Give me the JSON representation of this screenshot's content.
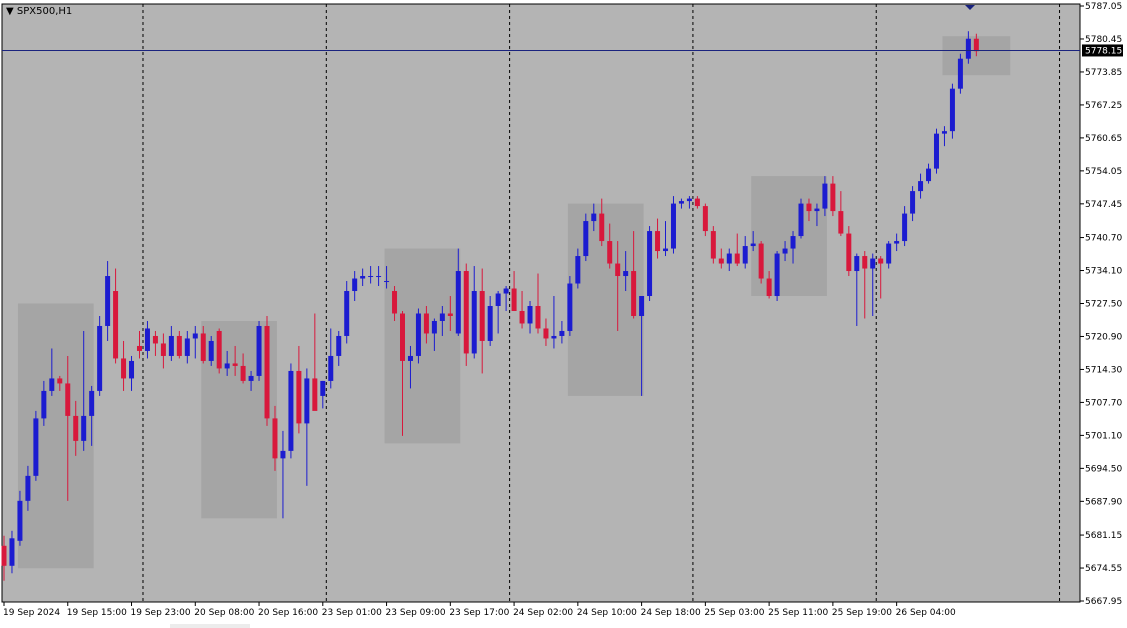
{
  "window": {
    "symbol_label": "SPX500,H1",
    "collapse_icon": "triangle-down-icon"
  },
  "colors": {
    "background": "#b4b4b4",
    "bull": "#1c1cd0",
    "bear": "#d8183c",
    "box": "#a5a5a5",
    "price_line": "#1a237e",
    "price_tag": "#000000"
  },
  "current_price": {
    "value": 5778.15,
    "label": "5778.15"
  },
  "chart_data": {
    "type": "candlestick",
    "title": "SPX500,H1",
    "ylim": [
      5667.95,
      5787.05
    ],
    "y_ticks": [
      "5787.05",
      "5780.45",
      "5773.85",
      "5767.25",
      "5760.65",
      "5754.05",
      "5747.45",
      "5740.70",
      "5734.10",
      "5727.50",
      "5720.90",
      "5714.30",
      "5707.70",
      "5701.10",
      "5694.50",
      "5687.90",
      "5681.15",
      "5674.55",
      "5667.95"
    ],
    "x_labels": [
      {
        "label": "19 Sep 2024",
        "index": 0
      },
      {
        "label": "19 Sep 15:00",
        "index": 8
      },
      {
        "label": "19 Sep 23:00",
        "index": 16
      },
      {
        "label": "20 Sep 08:00",
        "index": 24
      },
      {
        "label": "20 Sep 16:00",
        "index": 32
      },
      {
        "label": "23 Sep 01:00",
        "index": 40
      },
      {
        "label": "23 Sep 09:00",
        "index": 48
      },
      {
        "label": "23 Sep 17:00",
        "index": 56
      },
      {
        "label": "24 Sep 02:00",
        "index": 64
      },
      {
        "label": "24 Sep 10:00",
        "index": 72
      },
      {
        "label": "24 Sep 18:00",
        "index": 80
      },
      {
        "label": "25 Sep 03:00",
        "index": 88
      },
      {
        "label": "25 Sep 11:00",
        "index": 96
      },
      {
        "label": "25 Sep 19:00",
        "index": 104
      },
      {
        "label": "26 Sep 04:00",
        "index": 112
      }
    ],
    "day_separators": [
      17,
      40,
      63,
      86,
      109,
      132
    ],
    "session_boxes": [
      {
        "from": 2,
        "to": 11,
        "high": 5727.5,
        "low": 5674.5
      },
      {
        "from": 25,
        "to": 34,
        "high": 5724.0,
        "low": 5684.5
      },
      {
        "from": 48,
        "to": 57,
        "high": 5738.5,
        "low": 5699.5
      },
      {
        "from": 71,
        "to": 80,
        "high": 5747.5,
        "low": 5709.0
      },
      {
        "from": 94,
        "to": 103,
        "high": 5753.0,
        "low": 5729.0
      },
      {
        "from": 118,
        "to": 126,
        "high": 5781.0,
        "low": 5773.2
      }
    ],
    "candles": [
      [
        5679.0,
        5681.0,
        5672.0,
        5675.0
      ],
      [
        5675.0,
        5682.0,
        5673.5,
        5680.5
      ],
      [
        5680.0,
        5690.0,
        5679.0,
        5688.0
      ],
      [
        5688.0,
        5695.0,
        5686.0,
        5693.0
      ],
      [
        5693.0,
        5706.0,
        5692.0,
        5704.5
      ],
      [
        5704.5,
        5712.0,
        5703.0,
        5710.0
      ],
      [
        5710.0,
        5718.5,
        5709.0,
        5712.5
      ],
      [
        5712.5,
        5713.0,
        5710.0,
        5711.5
      ],
      [
        5711.5,
        5717.0,
        5688.0,
        5705.0
      ],
      [
        5705.0,
        5708.0,
        5697.0,
        5700.0
      ],
      [
        5700.0,
        5722.0,
        5698.0,
        5705.0
      ],
      [
        5705.0,
        5711.0,
        5699.0,
        5710.0
      ],
      [
        5710.0,
        5725.0,
        5709.0,
        5723.0
      ],
      [
        5723.0,
        5736.0,
        5720.0,
        5733.0
      ],
      [
        5730.0,
        5734.5,
        5715.5,
        5716.5
      ],
      [
        5716.5,
        5720.0,
        5710.0,
        5712.5
      ],
      [
        5712.5,
        5717.0,
        5710.0,
        5716.0
      ],
      [
        5719.0,
        5722.0,
        5716.5,
        5718.0
      ],
      [
        5718.0,
        5724.0,
        5716.5,
        5722.5
      ],
      [
        5721.0,
        5722.0,
        5717.0,
        5719.5
      ],
      [
        5719.5,
        5721.5,
        5714.5,
        5717.0
      ],
      [
        5717.0,
        5723.0,
        5716.0,
        5721.0
      ],
      [
        5721.0,
        5722.0,
        5716.5,
        5717.0
      ],
      [
        5717.0,
        5722.0,
        5715.5,
        5720.5
      ],
      [
        5720.5,
        5723.0,
        5716.5,
        5721.5
      ],
      [
        5721.5,
        5723.0,
        5715.5,
        5716.0
      ],
      [
        5716.0,
        5721.0,
        5715.0,
        5720.0
      ],
      [
        5722.0,
        5722.5,
        5713.5,
        5714.5
      ],
      [
        5714.5,
        5718.0,
        5713.0,
        5715.5
      ],
      [
        5715.5,
        5719.0,
        5713.0,
        5715.0
      ],
      [
        5715.0,
        5717.5,
        5711.5,
        5712.0
      ],
      [
        5712.0,
        5714.0,
        5710.0,
        5713.0
      ],
      [
        5713.0,
        5724.0,
        5712.0,
        5723.0
      ],
      [
        5723.0,
        5725.0,
        5703.0,
        5704.5
      ],
      [
        5704.5,
        5707.0,
        5694.0,
        5696.5
      ],
      [
        5696.5,
        5702.0,
        5684.5,
        5698.0
      ],
      [
        5698.0,
        5715.5,
        5696.5,
        5714.0
      ],
      [
        5714.0,
        5719.0,
        5701.5,
        5703.5
      ],
      [
        5703.5,
        5714.5,
        5691.0,
        5712.5
      ],
      [
        5712.5,
        5725.5,
        5708.0,
        5706.0
      ],
      [
        5709.0,
        5712.0,
        5706.5,
        5712.0
      ],
      [
        5712.0,
        5722.5,
        5710.5,
        5717.0
      ],
      [
        5717.0,
        5722.0,
        5715.0,
        5721.0
      ],
      [
        5721.0,
        5732.0,
        5719.5,
        5730.0
      ],
      [
        5730.0,
        5734.0,
        5728.0,
        5732.5
      ],
      [
        5732.5,
        5734.5,
        5731.0,
        5733.0
      ],
      [
        5733.0,
        5735.0,
        5731.5,
        5733.0
      ],
      [
        5733.0,
        5735.0,
        5731.0,
        5733.0
      ],
      [
        5732.0,
        5735.0,
        5730.5,
        5732.0
      ],
      [
        5730.0,
        5731.0,
        5724.0,
        5725.5
      ],
      [
        5725.5,
        5726.0,
        5701.0,
        5716.0
      ],
      [
        5716.0,
        5719.0,
        5710.5,
        5717.0
      ],
      [
        5717.0,
        5726.5,
        5715.5,
        5725.5
      ],
      [
        5725.5,
        5727.0,
        5719.5,
        5721.5
      ],
      [
        5721.5,
        5724.5,
        5718.0,
        5724.0
      ],
      [
        5724.0,
        5727.0,
        5721.0,
        5725.5
      ],
      [
        5725.5,
        5729.0,
        5722.0,
        5725.0
      ],
      [
        5721.5,
        5738.5,
        5721.0,
        5734.0
      ],
      [
        5734.0,
        5735.5,
        5715.0,
        5717.5
      ],
      [
        5717.5,
        5735.0,
        5716.5,
        5730.0
      ],
      [
        5730.0,
        5734.5,
        5713.5,
        5720.0
      ],
      [
        5720.0,
        5729.0,
        5719.0,
        5727.0
      ],
      [
        5727.0,
        5730.0,
        5721.5,
        5729.5
      ],
      [
        5729.5,
        5731.0,
        5726.0,
        5730.5
      ],
      [
        5730.5,
        5734.0,
        5727.0,
        5726.0
      ],
      [
        5726.0,
        5730.0,
        5722.5,
        5723.5
      ],
      [
        5723.5,
        5728.0,
        5721.5,
        5727.0
      ],
      [
        5727.0,
        5733.5,
        5721.5,
        5722.5
      ],
      [
        5722.5,
        5724.5,
        5719.0,
        5720.5
      ],
      [
        5720.5,
        5729.0,
        5718.5,
        5721.0
      ],
      [
        5721.0,
        5724.0,
        5719.5,
        5722.0
      ],
      [
        5722.0,
        5733.0,
        5721.0,
        5731.5
      ],
      [
        5731.5,
        5738.5,
        5730.5,
        5737.0
      ],
      [
        5737.0,
        5745.5,
        5736.0,
        5744.0
      ],
      [
        5744.0,
        5747.5,
        5742.0,
        5745.5
      ],
      [
        5745.5,
        5748.5,
        5739.0,
        5740.0
      ],
      [
        5740.0,
        5743.5,
        5734.5,
        5735.5
      ],
      [
        5735.5,
        5740.0,
        5722.0,
        5733.0
      ],
      [
        5733.0,
        5738.0,
        5730.0,
        5734.0
      ],
      [
        5734.0,
        5742.0,
        5724.5,
        5725.0
      ],
      [
        5725.0,
        5728.5,
        5709.0,
        5729.0
      ],
      [
        5729.0,
        5743.0,
        5728.0,
        5742.0
      ],
      [
        5742.0,
        5744.5,
        5736.5,
        5738.0
      ],
      [
        5738.0,
        5744.0,
        5737.0,
        5738.5
      ],
      [
        5738.5,
        5749.0,
        5737.5,
        5747.5
      ],
      [
        5747.5,
        5748.5,
        5746.5,
        5748.0
      ],
      [
        5748.0,
        5749.0,
        5746.5,
        5748.5
      ],
      [
        5748.5,
        5749.0,
        5746.5,
        5747.0
      ],
      [
        5747.0,
        5747.5,
        5741.0,
        5742.0
      ],
      [
        5742.0,
        5743.0,
        5735.5,
        5736.5
      ],
      [
        5736.5,
        5738.5,
        5734.5,
        5735.5
      ],
      [
        5735.5,
        5738.5,
        5734.0,
        5737.5
      ],
      [
        5737.5,
        5741.5,
        5735.0,
        5735.5
      ],
      [
        5735.5,
        5741.0,
        5734.5,
        5739.0
      ],
      [
        5739.0,
        5742.0,
        5738.0,
        5739.5
      ],
      [
        5739.5,
        5740.0,
        5731.5,
        5732.5
      ],
      [
        5732.5,
        5734.0,
        5728.5,
        5729.0
      ],
      [
        5729.0,
        5738.0,
        5728.0,
        5737.5
      ],
      [
        5737.5,
        5740.0,
        5736.0,
        5738.5
      ],
      [
        5738.5,
        5742.0,
        5735.5,
        5741.0
      ],
      [
        5741.0,
        5748.5,
        5740.5,
        5747.5
      ],
      [
        5747.5,
        5748.5,
        5744.0,
        5746.0
      ],
      [
        5746.0,
        5747.5,
        5743.0,
        5746.5
      ],
      [
        5746.5,
        5753.0,
        5745.0,
        5751.5
      ],
      [
        5751.5,
        5753.0,
        5745.0,
        5746.0
      ],
      [
        5746.0,
        5750.0,
        5741.0,
        5741.5
      ],
      [
        5741.5,
        5743.0,
        5733.0,
        5734.0
      ],
      [
        5734.0,
        5737.5,
        5723.0,
        5737.0
      ],
      [
        5737.0,
        5738.0,
        5724.5,
        5734.5
      ],
      [
        5734.5,
        5737.5,
        5725.0,
        5736.5
      ],
      [
        5736.5,
        5737.0,
        5728.5,
        5735.5
      ],
      [
        5735.5,
        5740.0,
        5734.5,
        5739.5
      ],
      [
        5739.5,
        5741.5,
        5738.0,
        5740.0
      ],
      [
        5740.0,
        5747.0,
        5739.0,
        5745.5
      ],
      [
        5745.5,
        5751.0,
        5744.0,
        5750.0
      ],
      [
        5750.0,
        5753.5,
        5748.5,
        5752.0
      ],
      [
        5752.0,
        5755.5,
        5751.5,
        5754.5
      ],
      [
        5754.5,
        5762.5,
        5753.5,
        5761.5
      ],
      [
        5761.5,
        5763.0,
        5759.0,
        5762.0
      ],
      [
        5762.0,
        5771.5,
        5760.5,
        5770.5
      ],
      [
        5770.5,
        5777.5,
        5769.5,
        5776.5
      ],
      [
        5776.5,
        5782.0,
        5775.5,
        5780.5
      ],
      [
        5780.5,
        5781.5,
        5777.0,
        5778.0
      ]
    ]
  }
}
